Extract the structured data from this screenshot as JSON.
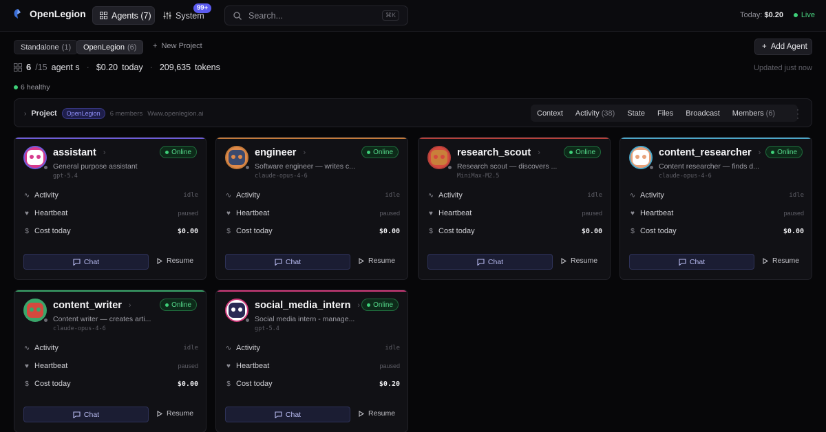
{
  "header": {
    "brand": "OpenLegion",
    "nav_agents": "Agents (7)",
    "nav_system": "System",
    "system_badge": "99+",
    "search_placeholder": "Search...",
    "search_shortcut": "⌘K",
    "today_label": "Today:",
    "today_value": "$0.20",
    "live_label": "Live"
  },
  "projects": {
    "standalone_label": "Standalone",
    "standalone_count": "(1)",
    "active_label": "OpenLegion",
    "active_count": "(6)",
    "new_project": "New Project",
    "add_agent": "Add Agent"
  },
  "stats": {
    "agents_count": "6",
    "agents_total": "/15",
    "agents_label": "agent s",
    "cost": "$0.20",
    "cost_label": "today",
    "tokens": "209,635",
    "tokens_label": "tokens",
    "updated": "Updated just now",
    "healthy": "6 healthy"
  },
  "project_bar": {
    "title": "Project",
    "badge": "OpenLegion",
    "members": "6 members",
    "url": "Www.openlegion.ai",
    "tabs": [
      {
        "label": "Context",
        "count": ""
      },
      {
        "label": "Activity",
        "count": "(38)"
      },
      {
        "label": "State",
        "count": ""
      },
      {
        "label": "Files",
        "count": ""
      },
      {
        "label": "Broadcast",
        "count": ""
      },
      {
        "label": "Members",
        "count": "(6)"
      }
    ]
  },
  "card_labels": {
    "status": "Online",
    "activity": "Activity",
    "heartbeat": "Heartbeat",
    "cost_today": "Cost today",
    "chat": "Chat",
    "resume": "Resume"
  },
  "agents": [
    {
      "name": "assistant",
      "description": "General purpose assistant",
      "model": "gpt-5.4",
      "activity": "idle",
      "heartbeat": "paused",
      "cost": "$0.00",
      "accent": "#6d5bd8",
      "avatar_bg": "#d63a8e",
      "face": "#ffffff"
    },
    {
      "name": "engineer",
      "description": "Software engineer — writes c...",
      "model": "claude-opus-4-6",
      "activity": "idle",
      "heartbeat": "paused",
      "cost": "$0.00",
      "accent": "#c47a3a",
      "avatar_bg": "#e08a4a",
      "face": "#3b4a6e"
    },
    {
      "name": "research_scout",
      "description": "Research scout — discovers ...",
      "model": "MiniMax-M2.5",
      "activity": "idle",
      "heartbeat": "paused",
      "cost": "$0.00",
      "accent": "#b6403a",
      "avatar_bg": "#d4493e",
      "face": "#c9803a"
    },
    {
      "name": "content_researcher",
      "description": "Content researcher — finds d...",
      "model": "claude-opus-4-6",
      "activity": "idle",
      "heartbeat": "paused",
      "cost": "$0.00",
      "accent": "#4aa6c8",
      "avatar_bg": "#e8a27a",
      "face": "#ffffff"
    },
    {
      "name": "content_writer",
      "description": "Content writer — creates arti...",
      "model": "claude-opus-4-6",
      "activity": "idle",
      "heartbeat": "paused",
      "cost": "$0.00",
      "accent": "#3aa66a",
      "avatar_bg": "#3aa66a",
      "face": "#d4493e"
    },
    {
      "name": "social_media_intern",
      "description": "Social media intern - manage...",
      "model": "gpt-5.4",
      "activity": "idle",
      "heartbeat": "paused",
      "cost": "$0.20",
      "accent": "#d03a7a",
      "avatar_bg": "#ffffff",
      "face": "#2a2a55"
    }
  ]
}
